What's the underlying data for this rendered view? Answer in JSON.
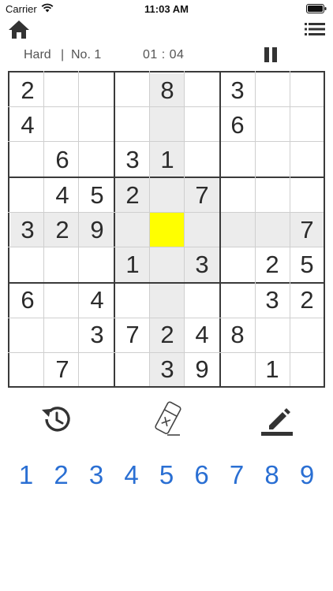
{
  "status_bar": {
    "carrier": "Carrier",
    "time": "11:03 AM"
  },
  "info": {
    "difficulty": "Hard",
    "separator": "|",
    "puzzle_no": "No. 1",
    "timer": "01 : 04"
  },
  "icons": {
    "home": "home-icon",
    "menu": "list-menu-icon",
    "pause": "pause-icon",
    "undo": "history-undo-icon",
    "erase": "eraser-icon",
    "pencil": "pencil-notes-icon"
  },
  "colors": {
    "highlight": "#ececec",
    "selected": "#ffff00",
    "number_pad": "#2a6fd3",
    "grid_thick": "#3a3a3a",
    "grid_thin": "#cfcfcf"
  },
  "board": {
    "selected": {
      "row": 4,
      "col": 4
    },
    "cells": [
      [
        "2",
        "",
        "",
        "",
        "8",
        "",
        "3",
        "",
        ""
      ],
      [
        "4",
        "",
        "",
        "",
        "",
        "",
        "6",
        "",
        ""
      ],
      [
        "",
        "6",
        "",
        "3",
        "1",
        "",
        "",
        "",
        ""
      ],
      [
        "",
        "4",
        "5",
        "2",
        "",
        "7",
        "",
        "",
        ""
      ],
      [
        "3",
        "2",
        "9",
        "",
        "",
        "",
        "",
        "",
        "7"
      ],
      [
        "",
        "",
        "",
        "1",
        "",
        "3",
        "",
        "2",
        "5"
      ],
      [
        "6",
        "",
        "4",
        "",
        "",
        "",
        "",
        "3",
        "2"
      ],
      [
        "",
        "",
        "3",
        "7",
        "2",
        "4",
        "8",
        "",
        ""
      ],
      [
        "",
        "7",
        "",
        "",
        "3",
        "9",
        "",
        "1",
        ""
      ]
    ]
  },
  "number_pad": [
    "1",
    "2",
    "3",
    "4",
    "5",
    "6",
    "7",
    "8",
    "9"
  ]
}
